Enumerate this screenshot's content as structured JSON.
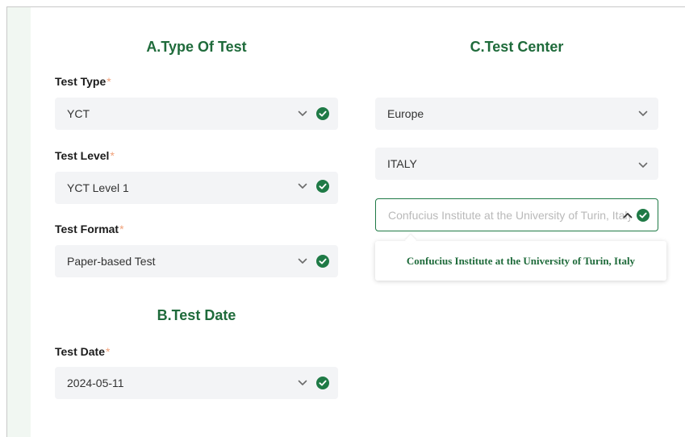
{
  "section_a": {
    "title": "A.Type Of Test",
    "test_type": {
      "label": "Test Type",
      "required": "*",
      "value": "YCT"
    },
    "test_level": {
      "label": "Test Level",
      "required": "*",
      "value": "YCT Level 1"
    },
    "test_format": {
      "label": "Test Format",
      "required": "*",
      "value": "Paper-based Test"
    }
  },
  "section_b": {
    "title": "B.Test Date",
    "test_date": {
      "label": "Test Date",
      "required": "*",
      "value": "2024-05-11"
    }
  },
  "section_c": {
    "title": "C.Test Center",
    "continent": {
      "value": "Europe"
    },
    "country": {
      "value": "ITALY"
    },
    "center": {
      "value": "Confucius Institute at the University of Turin, Italy"
    },
    "dropdown_options": [
      "Confucius Institute at the University of Turin, Italy"
    ]
  },
  "icons": {
    "chevron": "chevron-down-icon",
    "chevron_up": "chevron-up-icon",
    "valid": "check-circle-icon"
  },
  "colors": {
    "accent_green": "#1f6b3b",
    "check_green": "#1f7a46",
    "required_asterisk": "#f0a17a",
    "field_bg": "#f3f4f6"
  }
}
